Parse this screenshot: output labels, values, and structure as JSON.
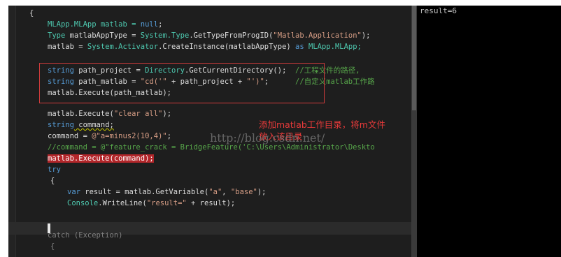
{
  "editor": {
    "lines": {
      "l0": "{",
      "l1a": "MLApp.MLApp matlab = ",
      "l1b": "null",
      "l1c": ";",
      "l2a": "Type",
      "l2b": " matlabAppType = ",
      "l2c": "System.Type",
      "l2d": ".GetTypeFromProgID(",
      "l2e": "\"Matlab.Application\"",
      "l2f": ");",
      "l3a": "matlab = ",
      "l3b": "System.Activator",
      "l3c": ".CreateInstance(matlabAppType) ",
      "l3d": "as",
      "l3e": " MLApp.MLApp;",
      "l4a": "string",
      "l4b": " path_project = ",
      "l4c": "Directory",
      "l4d": ".GetCurrentDirectory();",
      "l4e": "  //工程文件的路径,",
      "l5a": "string",
      "l5b": " path_matlab = ",
      "l5c": "\"cd('\"",
      "l5d": " + path_project + ",
      "l5e": "\"')\"",
      "l5f": ";",
      "l5g": "      //自定义matlab工作路",
      "l6": "matlab.Execute(path_matlab);",
      "l7a": "matlab.Execute(",
      "l7b": "\"clear all\"",
      "l7c": ");",
      "l8a": "string",
      "l8b": " command;",
      "l9a": "command = ",
      "l9b": "@\"a=minus2(10,4)\"",
      "l9c": ";",
      "l10": "//command = @\"feature_crack = BridgeFeature('C:\\Users\\Administrator\\Deskto",
      "l11": "matlab.Execute(command);",
      "l12": "try",
      "l13": "{",
      "l14a": "var",
      "l14b": " result = matlab.GetVariable(",
      "l14c": "\"a\"",
      "l14d": ", ",
      "l14e": "\"base\"",
      "l14f": ");",
      "l15a": "Console",
      "l15b": ".WriteLine(",
      "l15c": "\"result=\"",
      "l15d": " + result);",
      "l16": "catch (Exception)",
      "l17": "{"
    }
  },
  "annotation": {
    "line1": "添加matlab工作目录，将m文件",
    "line2": "放入该目录"
  },
  "watermark": "http://blog.csdn.net/",
  "console": {
    "output": "result=6"
  }
}
